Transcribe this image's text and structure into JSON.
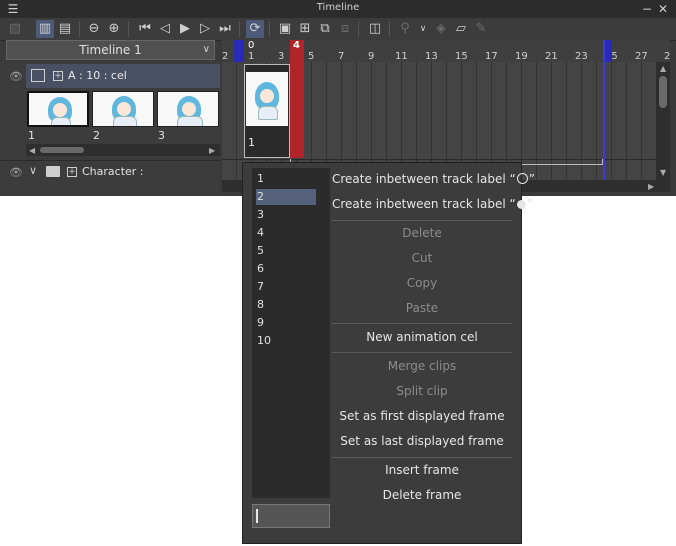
{
  "window": {
    "title": "Timeline"
  },
  "titlebar": {
    "menu_icon": "☰",
    "minimize_icon": "−",
    "close_icon": "✕"
  },
  "toolbar": {
    "icons": [
      "onion-skin-icon",
      "cel-view-icon",
      "thumbnail-view-icon",
      "zoom-out-icon",
      "zoom-in-icon",
      "first-frame-icon",
      "prev-frame-icon",
      "play-icon",
      "next-frame-icon",
      "last-frame-icon",
      "loop-icon",
      "new-animation-folder-icon",
      "new-animation-cel-icon",
      "assign-cel-icon",
      "specify-cel-icon",
      "new-keyframe-layer-icon",
      "link-icon",
      "keyframe-icon",
      "pen-icon"
    ]
  },
  "timeline_selector": {
    "value": "Timeline 1"
  },
  "layers": {
    "a": {
      "name": "A : 10 : cel"
    },
    "thumbnails": [
      "1",
      "2",
      "3"
    ],
    "character": {
      "name": "Character :"
    }
  },
  "ruler": {
    "zero": "0",
    "current": "4",
    "labels": [
      "2",
      "1",
      "3",
      "5",
      "7",
      "9",
      "11",
      "13",
      "15",
      "17",
      "19",
      "21",
      "23",
      "25",
      "27",
      "2"
    ]
  },
  "track": {
    "cel_label": "1"
  },
  "context_menu": {
    "cel_list": [
      "1",
      "2",
      "3",
      "4",
      "5",
      "6",
      "7",
      "8",
      "9",
      "10"
    ],
    "selected_index": 1,
    "input_value": "",
    "items": {
      "inbetween_hollow": "Create inbetween track label “",
      "inbetween_hollow_end": "”",
      "inbetween_filled": "Create inbetween track label “",
      "inbetween_filled_end": "”",
      "delete": "Delete",
      "cut": "Cut",
      "copy": "Copy",
      "paste": "Paste",
      "new_cel": "New animation cel",
      "merge": "Merge clips",
      "split": "Split clip",
      "first_frame": "Set as first displayed frame",
      "last_frame": "Set as last displayed frame",
      "insert_frame": "Insert frame",
      "delete_frame": "Delete frame"
    }
  },
  "colors": {
    "accent": "#55607a",
    "playhead": "#b0242a",
    "range_marker": "#2a2ab8"
  }
}
